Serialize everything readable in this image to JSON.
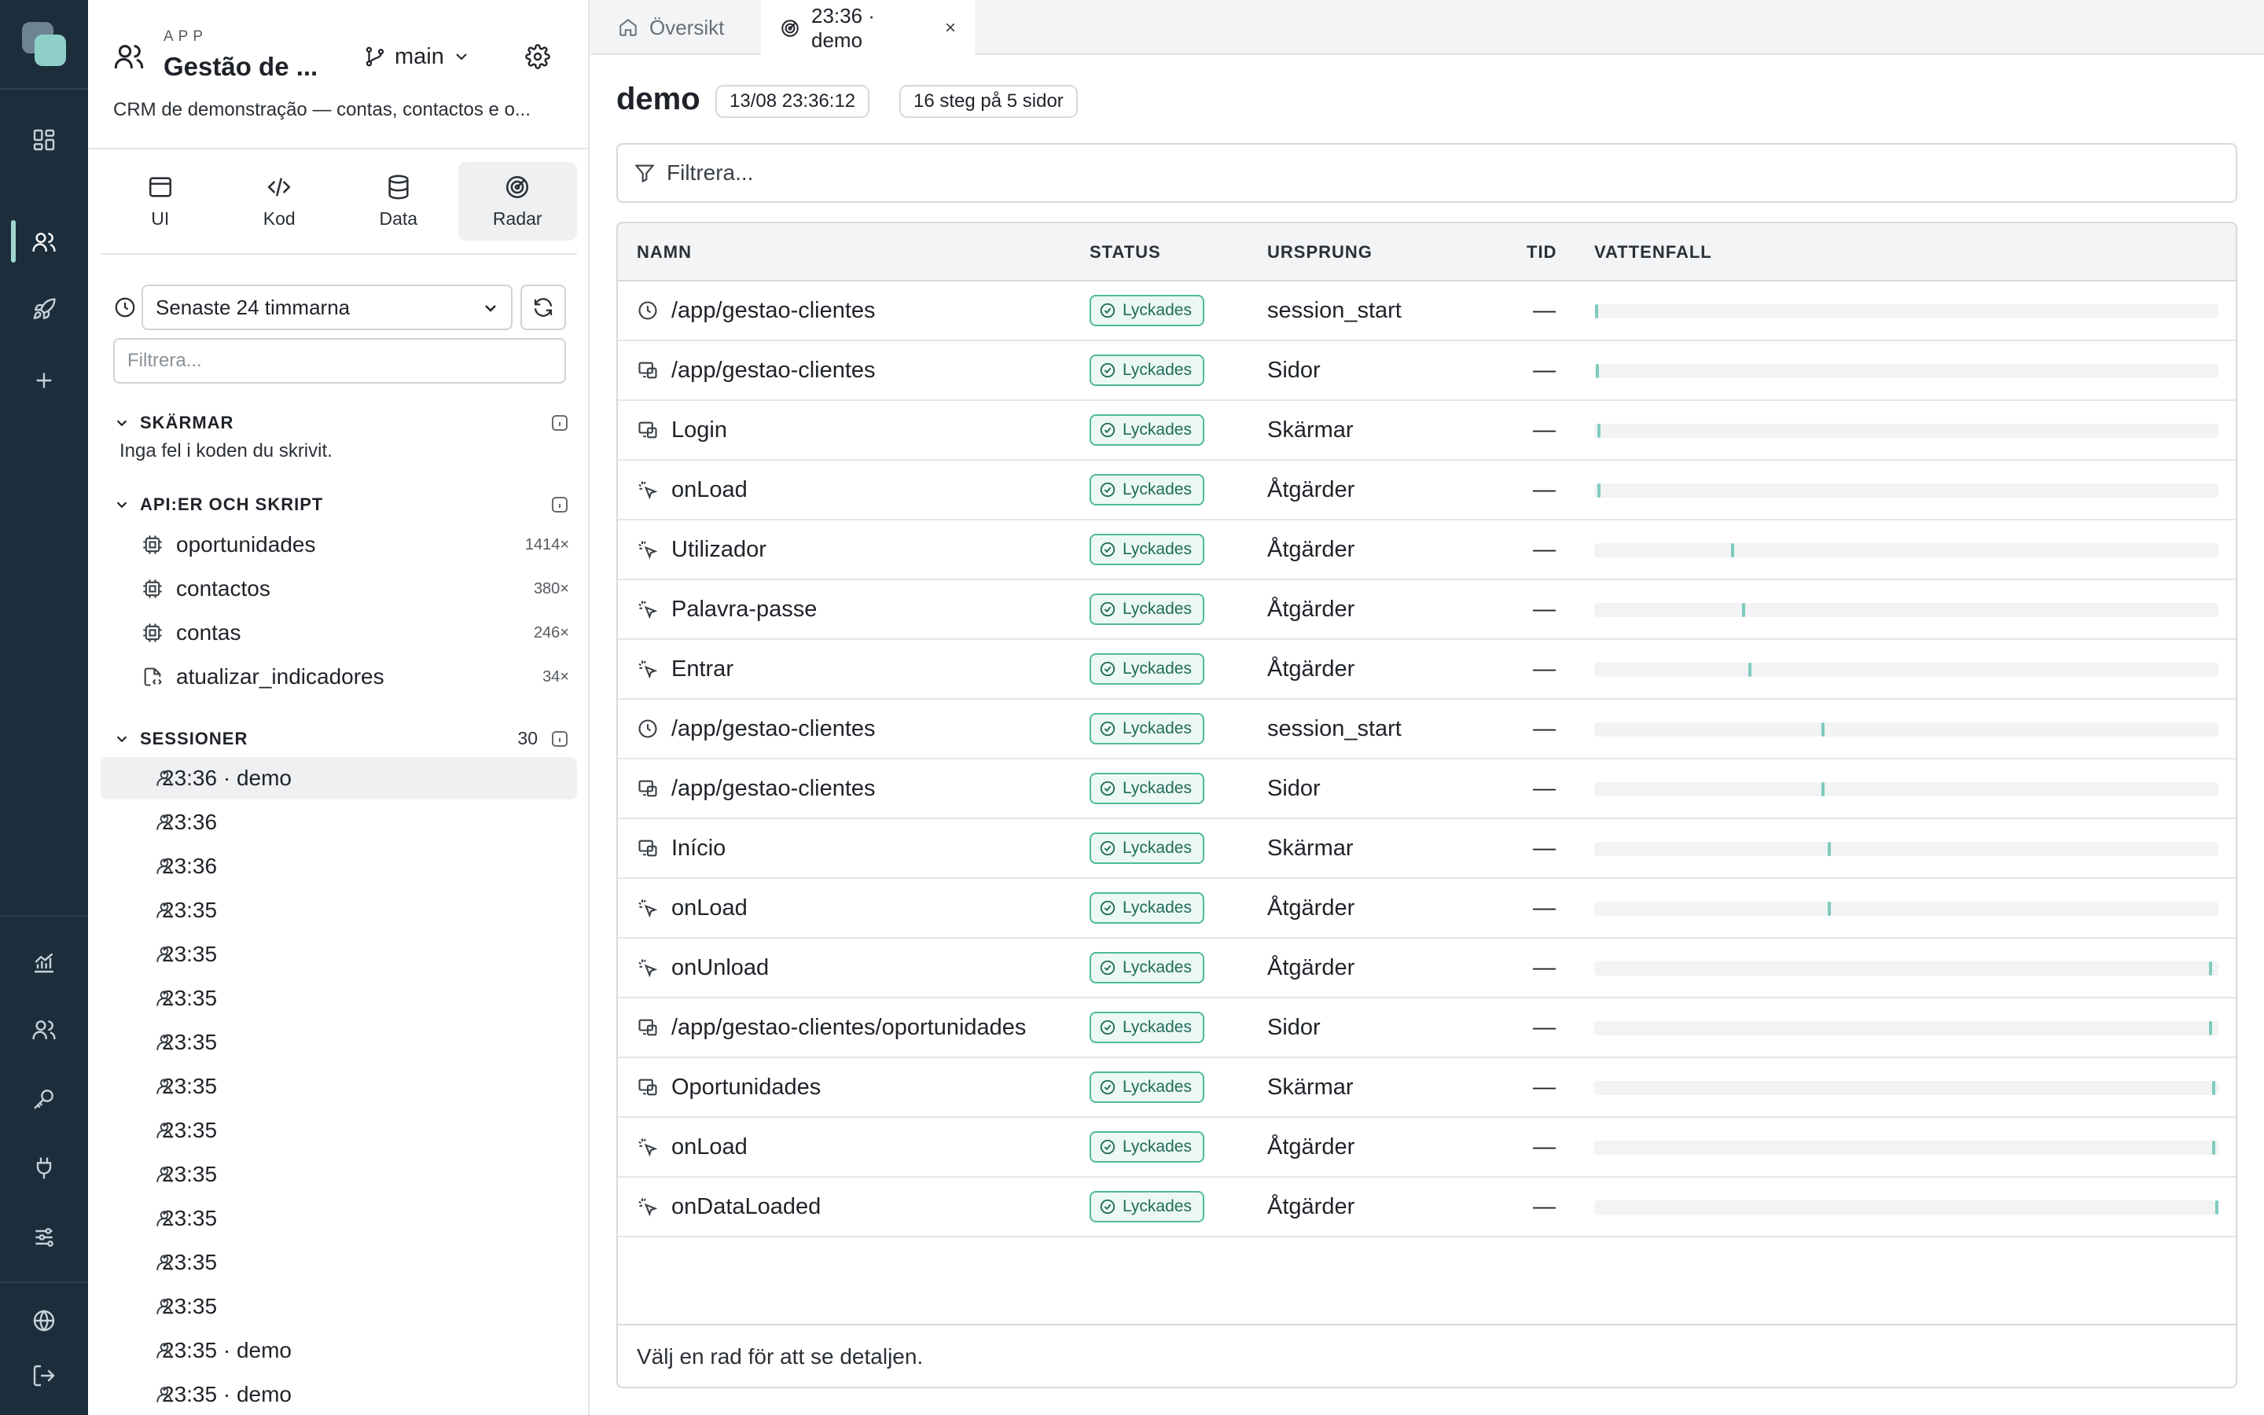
{
  "rail": {
    "items": [
      {
        "name": "dashboard-icon"
      },
      {
        "name": "users-icon"
      },
      {
        "name": "rocket-icon"
      },
      {
        "name": "plus-icon"
      },
      {
        "name": "chart-icon"
      },
      {
        "name": "team-icon"
      },
      {
        "name": "key-icon"
      },
      {
        "name": "plug-icon"
      },
      {
        "name": "sliders-icon"
      },
      {
        "name": "globe-icon"
      },
      {
        "name": "logout-icon"
      }
    ]
  },
  "app": {
    "kicker": "APP",
    "title": "Gestão de ...",
    "branch": "main",
    "description": "CRM de demonstração — contas, contactos e o..."
  },
  "modes": [
    {
      "label": "UI",
      "icon": "window-icon"
    },
    {
      "label": "Kod",
      "icon": "code-icon"
    },
    {
      "label": "Data",
      "icon": "database-icon"
    },
    {
      "label": "Radar",
      "icon": "radar-icon",
      "active": true
    }
  ],
  "sidebar": {
    "time_range": "Senaste 24 timmarna",
    "filter_placeholder": "Filtrera...",
    "screens": {
      "title": "SKÄRMAR",
      "note": "Inga fel i koden du skrivit."
    },
    "apis": {
      "title": "API:ER OCH SKRIPT",
      "items": [
        {
          "label": "oportunidades",
          "count": "1414×",
          "icon": "chip-icon"
        },
        {
          "label": "contactos",
          "count": "380×",
          "icon": "chip-icon"
        },
        {
          "label": "contas",
          "count": "246×",
          "icon": "chip-icon"
        },
        {
          "label": "atualizar_indicadores",
          "count": "34×",
          "icon": "script-icon"
        }
      ]
    },
    "sessions": {
      "title": "SESSIONER",
      "count": "30",
      "items": [
        "23:36 · demo",
        "23:36",
        "23:36",
        "23:35",
        "23:35",
        "23:35",
        "23:35",
        "23:35",
        "23:35",
        "23:35",
        "23:35",
        "23:35",
        "23:35",
        "23:35 · demo",
        "23:35 · demo"
      ]
    }
  },
  "tabs": [
    {
      "label": "Översikt",
      "icon": "home-icon"
    },
    {
      "label": "23:36 · demo",
      "icon": "radar-icon",
      "close": "×",
      "active": true
    }
  ],
  "main": {
    "title": "demo",
    "timestamp": "13/08 23:36:12",
    "steps": "16 steg på 5 sidor",
    "filter_placeholder": "Filtrera...",
    "columns": {
      "name": "NAMN",
      "status": "STATUS",
      "origin": "URSPRUNG",
      "time": "TID",
      "waterfall": "VATTENFALL"
    },
    "footer": "Välj en rad för att se detaljen."
  },
  "rows": [
    {
      "icon": "clock-icon",
      "name": "/app/gestao-clientes",
      "status": "Lyckades",
      "origin": "session_start",
      "time": "—",
      "wf": 0.001
    },
    {
      "icon": "page-icon",
      "name": "/app/gestao-clientes",
      "status": "Lyckades",
      "origin": "Sidor",
      "time": "—",
      "wf": 0.003
    },
    {
      "icon": "page-icon",
      "name": "Login",
      "status": "Lyckades",
      "origin": "Skärmar",
      "time": "—",
      "wf": 0.005
    },
    {
      "icon": "pointer-icon",
      "name": "onLoad",
      "status": "Lyckades",
      "origin": "Åtgärder",
      "time": "—",
      "wf": 0.005
    },
    {
      "icon": "pointer-icon",
      "name": "Utilizador",
      "status": "Lyckades",
      "origin": "Åtgärder",
      "time": "—",
      "wf": 0.22
    },
    {
      "icon": "pointer-icon",
      "name": "Palavra-passe",
      "status": "Lyckades",
      "origin": "Åtgärder",
      "time": "—",
      "wf": 0.238
    },
    {
      "icon": "pointer-icon",
      "name": "Entrar",
      "status": "Lyckades",
      "origin": "Åtgärder",
      "time": "—",
      "wf": 0.248
    },
    {
      "icon": "clock-icon",
      "name": "/app/gestao-clientes",
      "status": "Lyckades",
      "origin": "session_start",
      "time": "—",
      "wf": 0.366
    },
    {
      "icon": "page-icon",
      "name": "/app/gestao-clientes",
      "status": "Lyckades",
      "origin": "Sidor",
      "time": "—",
      "wf": 0.366
    },
    {
      "icon": "page-icon",
      "name": "Início",
      "status": "Lyckades",
      "origin": "Skärmar",
      "time": "—",
      "wf": 0.376
    },
    {
      "icon": "pointer-icon",
      "name": "onLoad",
      "status": "Lyckades",
      "origin": "Åtgärder",
      "time": "—",
      "wf": 0.376
    },
    {
      "icon": "pointer-icon",
      "name": "onUnload",
      "status": "Lyckades",
      "origin": "Åtgärder",
      "time": "—",
      "wf": 0.99
    },
    {
      "icon": "page-icon",
      "name": "/app/gestao-clientes/oportunidades",
      "status": "Lyckades",
      "origin": "Sidor",
      "time": "—",
      "wf": 0.99
    },
    {
      "icon": "page-icon",
      "name": "Oportunidades",
      "status": "Lyckades",
      "origin": "Skärmar",
      "time": "—",
      "wf": 0.995
    },
    {
      "icon": "pointer-icon",
      "name": "onLoad",
      "status": "Lyckades",
      "origin": "Åtgärder",
      "time": "—",
      "wf": 0.995
    },
    {
      "icon": "pointer-icon",
      "name": "onDataLoaded",
      "status": "Lyckades",
      "origin": "Åtgärder",
      "time": "—",
      "wf": 1.0
    }
  ],
  "colors": {
    "rail_bg": "#1c2e3b",
    "accent": "#8ed0c8",
    "success_border": "#4fb99f",
    "success_text": "#1f6b58",
    "waterfall_mark": "#7ecbbe"
  }
}
